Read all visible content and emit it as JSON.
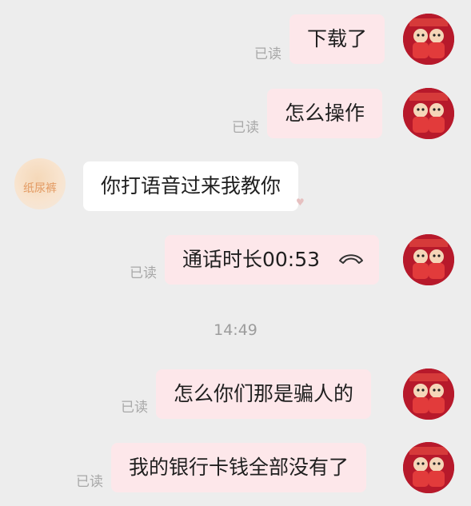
{
  "messages": [
    {
      "id": "m1",
      "side": "right",
      "text": "下载了",
      "status": "已读"
    },
    {
      "id": "m2",
      "side": "right",
      "text": "怎么操作",
      "status": "已读"
    },
    {
      "id": "m3",
      "side": "left",
      "text": "你打语音过来我教你",
      "sender_avatar_text": "纸尿裤"
    },
    {
      "id": "m4",
      "side": "right",
      "text": "通话时长00:53",
      "status": "已读",
      "icon": "phone-hangup-icon"
    },
    {
      "id": "m5",
      "side": "right",
      "text": "怎么你们那是骗人的",
      "status": "已读"
    },
    {
      "id": "m6",
      "side": "right",
      "text": "我的银行卡钱全部没有了",
      "status": "已读"
    }
  ],
  "timestamp": "14:49",
  "colors": {
    "background": "#ededed",
    "right_bubble": "#fde7ea",
    "left_bubble": "#ffffff",
    "read_status": "#a8a8a8",
    "avatar_red": "#b7192b"
  }
}
